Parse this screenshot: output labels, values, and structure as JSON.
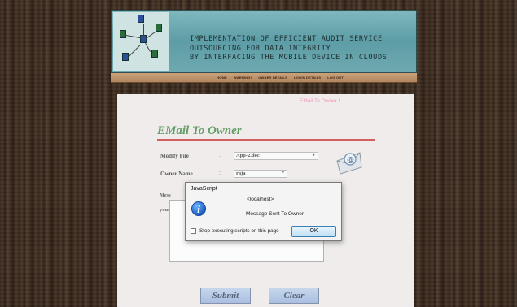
{
  "header": {
    "title_lines": [
      "IMPLEMENTATION OF EFFICIENT AUDIT SERVICE",
      "OUTSOURCING FOR DATA INTEGRITY",
      "BY INTERFACING THE MOBILE DEVICE IN CLOUDS"
    ]
  },
  "nav": {
    "items": [
      "HOME",
      "WARNING!",
      "OWNER DETAILS",
      "LOGIN DETAILS",
      "LOG OUT"
    ]
  },
  "page": {
    "top_link": "EMail To Owner !",
    "title": "EMail To Owner",
    "fields": {
      "modify_file_label": "Modify File",
      "modify_file_value": "App-2.doc",
      "owner_name_label": "Owner Name",
      "owner_name_value": "raja",
      "message_label_fragment": "Mess",
      "message_text_fragment": "your"
    },
    "colon": ":",
    "submit_label": "Submit",
    "clear_label": "Clear"
  },
  "dialog": {
    "title": "JavaScript",
    "host": "<localhost>",
    "message": "Message Sent To Owner",
    "checkbox_label": "Stop executing scripts on this page",
    "ok_label": "OK"
  },
  "icons": {
    "info": "info-icon",
    "mail": "email-at-icon",
    "dropdown": "chevron-down-icon",
    "network_logo": "network-computers-icon"
  },
  "colors": {
    "title_green": "#2e7d32",
    "divider_red": "#c62828",
    "header_teal": "#6fa9b0",
    "top_link_pink": "#e57aa3"
  }
}
